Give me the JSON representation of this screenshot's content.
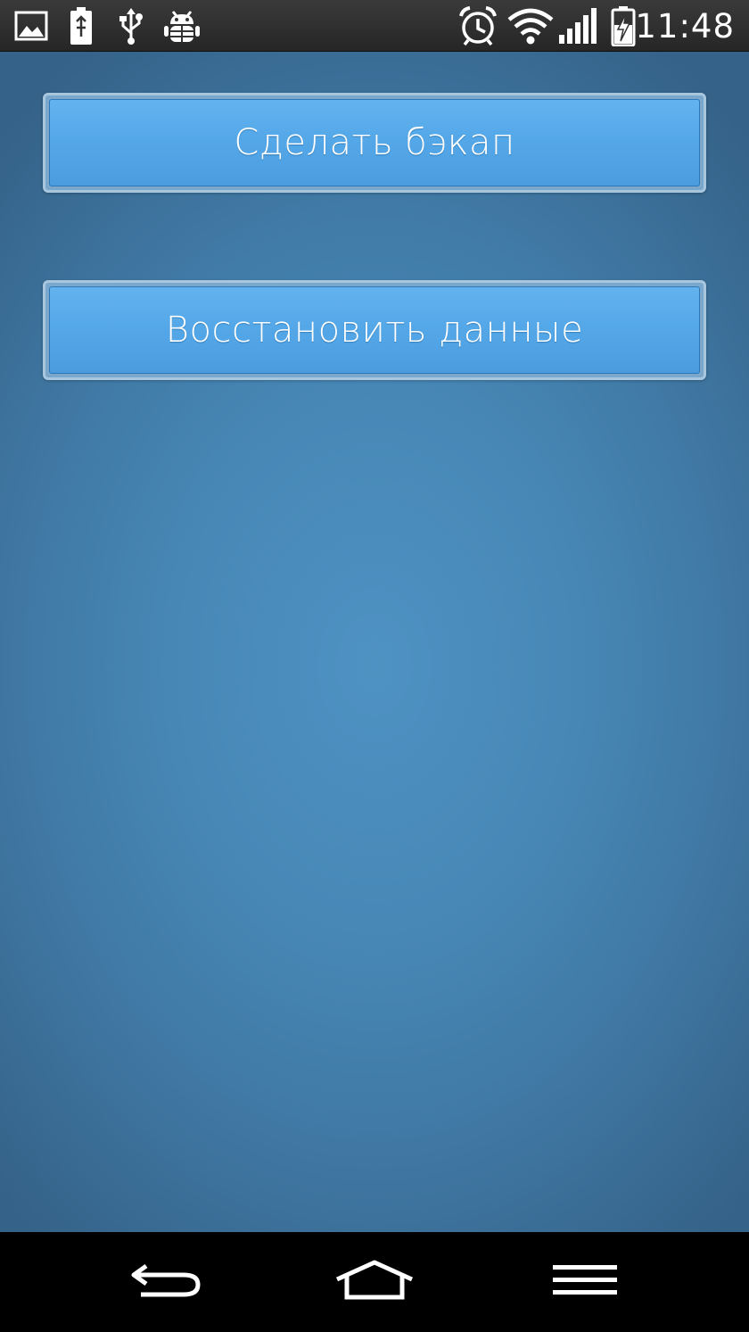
{
  "status_bar": {
    "time": "11:48",
    "icons": {
      "left": [
        "image-notification-icon",
        "battery-saver-icon",
        "usb-icon",
        "android-debug-icon"
      ],
      "right": [
        "alarm-clock-icon",
        "wifi-icon",
        "signal-strength-icon",
        "battery-charging-icon"
      ]
    }
  },
  "main": {
    "backup_button": "Сделать бэкап",
    "restore_button": "Восстановить данные"
  },
  "nav_bar": {
    "icons": [
      "back-icon",
      "home-icon",
      "menu-icon"
    ]
  },
  "colors": {
    "background_center": "#4e92c3",
    "background_edge": "#356288",
    "button_fill": "#55a8e8",
    "button_border": "#a8c6de"
  }
}
